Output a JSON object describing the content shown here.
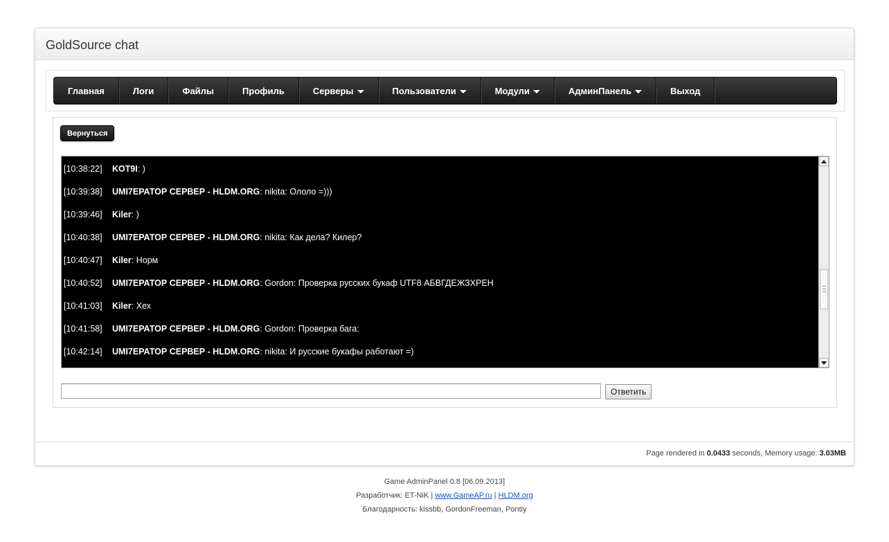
{
  "header": {
    "title": "GoldSource chat"
  },
  "nav": {
    "items": [
      {
        "label": "Главная",
        "dropdown": false
      },
      {
        "label": "Логи",
        "dropdown": false
      },
      {
        "label": "Файлы",
        "dropdown": false
      },
      {
        "label": "Профиль",
        "dropdown": false
      },
      {
        "label": "Серверы",
        "dropdown": true
      },
      {
        "label": "Пользователи",
        "dropdown": true
      },
      {
        "label": "Модули",
        "dropdown": true
      },
      {
        "label": "АдминПанель",
        "dropdown": true
      },
      {
        "label": "Выход",
        "dropdown": false
      }
    ]
  },
  "back_button": {
    "label": "Вернуться"
  },
  "chat": {
    "messages": [
      {
        "time": "[10:38:22]",
        "nick": "KOT9I",
        "text": ": )"
      },
      {
        "time": "[10:39:38]",
        "nick": "UMI7ЕРАТОР СЕРВЕР - HLDM.ORG",
        "text": ": nikita: Ололо =)))"
      },
      {
        "time": "[10:39:46]",
        "nick": "Kiler",
        "text": ": )"
      },
      {
        "time": "[10:40:38]",
        "nick": "UMI7ЕРАТОР СЕРВЕР - HLDM.ORG",
        "text": ": nikita: Как дела? Килер?"
      },
      {
        "time": "[10:40:47]",
        "nick": "Kiler",
        "text": ": Норм"
      },
      {
        "time": "[10:40:52]",
        "nick": "UMI7ЕРАТОР СЕРВЕР - HLDM.ORG",
        "text": ": Gordon: Проверка русских букаф UTF8 АБВГДЕЖЗХРЕН"
      },
      {
        "time": "[10:41:03]",
        "nick": "Kiler",
        "text": ": Хех"
      },
      {
        "time": "[10:41:58]",
        "nick": "UMI7ЕРАТОР СЕРВЕР - HLDM.ORG",
        "text": ": Gordon: Проверка бага:"
      },
      {
        "time": "[10:42:14]",
        "nick": "UMI7ЕРАТОР СЕРВЕР - HLDM.ORG",
        "text": ": nikita: И русские букафы работают =)"
      }
    ]
  },
  "reply": {
    "value": "",
    "button_label": "Ответить"
  },
  "footer": {
    "prefix": "Page rendered in ",
    "time": "0.0433",
    "middle": " seconds, Memory usage: ",
    "memory": "3.03MB"
  },
  "credits": {
    "version": "Game AdminPanel 0.8 [06.09.2013]",
    "dev_prefix": "Разработчик: ET-NiK | ",
    "link1": "www.GameAP.ru",
    "separator": " | ",
    "link2": "HLDM.org",
    "thanks": "Благодарность: kissbb, GordonFreeman, Pontiy"
  },
  "icons": {
    "caret": "caret-down-icon",
    "scroll_up": "arrow-up-icon",
    "scroll_down": "arrow-down-icon"
  }
}
